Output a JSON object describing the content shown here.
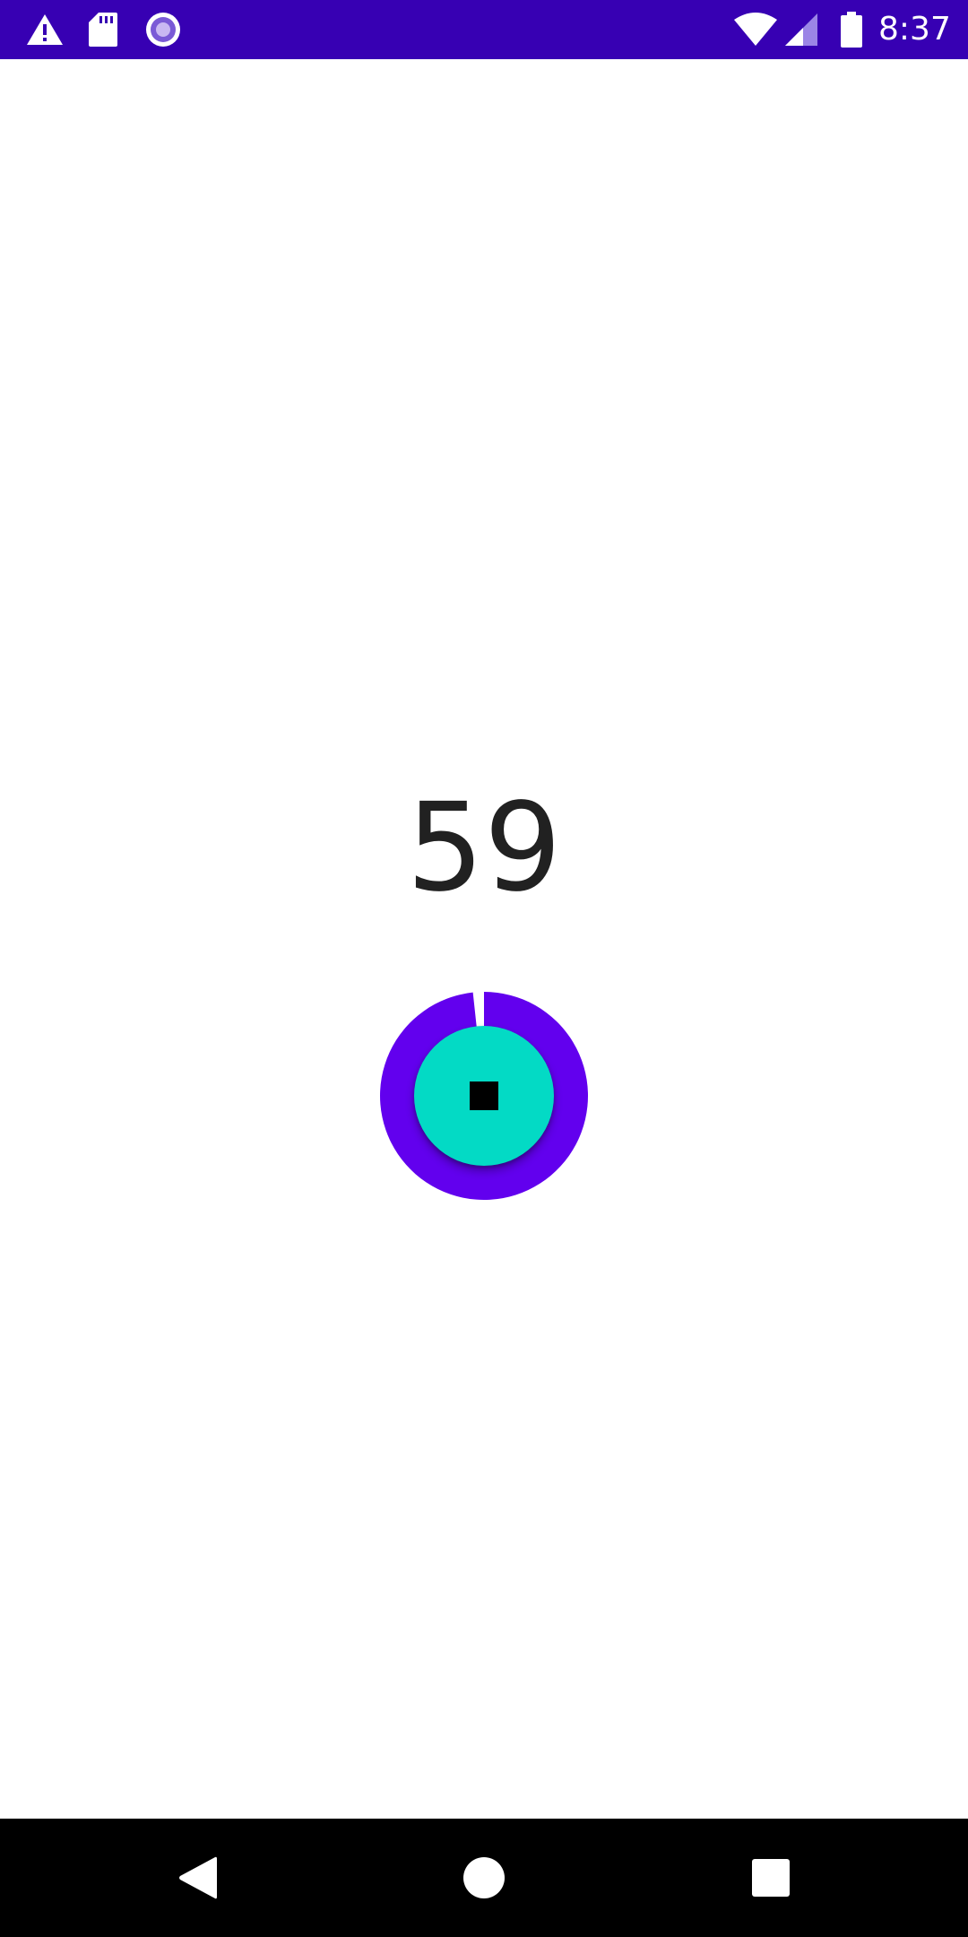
{
  "status_bar": {
    "time": "8:37",
    "icons": [
      "warning-icon",
      "sd-card-icon",
      "record-icon",
      "wifi-icon",
      "cell-signal-icon",
      "battery-icon"
    ],
    "background_color": "#3700b3"
  },
  "timer": {
    "remaining": "59",
    "progress_fraction": 0.983,
    "ring_color": "#6200ee",
    "button_color": "#03dac5",
    "button_icon": "stop-icon"
  },
  "nav_bar": {
    "icons": [
      "back-icon",
      "home-icon",
      "recents-icon"
    ]
  }
}
